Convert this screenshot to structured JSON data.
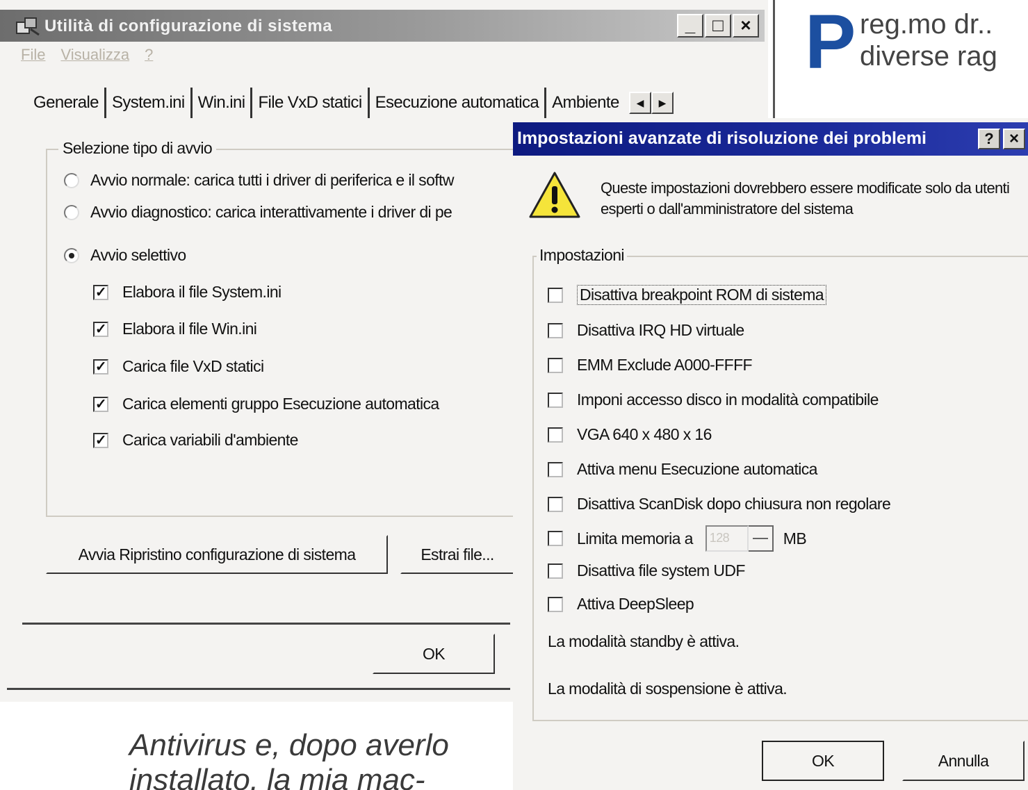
{
  "main_window": {
    "title": "Utilità di configurazione di sistema",
    "caption_buttons": {
      "minimize": "_",
      "maximize": "□",
      "close": "×"
    },
    "menu": [
      "File",
      "Visualizza",
      "?"
    ],
    "tabs": [
      "Generale",
      "System.ini",
      "Win.ini",
      "File VxD statici",
      "Esecuzione automatica",
      "Ambiente"
    ],
    "tab_scroll": {
      "left": "◀",
      "right": "▶"
    },
    "startup_group": {
      "legend": "Selezione tipo di avvio",
      "radio_normal": "Avvio normale: carica tutti i driver di periferica e il softw",
      "radio_diagnostic": "Avvio diagnostico: carica interattivamente i driver di pe",
      "radio_selective": "Avvio selettivo",
      "selected_radio": "radio_selective",
      "checks": [
        {
          "label": "Elabora il file System.ini",
          "checked": true
        },
        {
          "label": "Elabora il file Win.ini",
          "checked": true
        },
        {
          "label": "Carica file VxD statici",
          "checked": true
        },
        {
          "label": "Carica elementi gruppo Esecuzione automatica",
          "checked": true
        },
        {
          "label": "Carica variabili d'ambiente",
          "checked": true
        }
      ]
    },
    "buttons": {
      "restore": "Avvia Ripristino configurazione di sistema",
      "extract": "Estrai file...",
      "ok": "OK"
    }
  },
  "advanced_dialog": {
    "title": "Impostazioni avanzate di risoluzione dei problemi",
    "help_button": "?",
    "close_button": "×",
    "warning_text": "Queste impostazioni dovrebbero essere modificate solo da utenti esperti o dall'amministratore del sistema",
    "group_legend": "Impostazioni",
    "options": [
      {
        "label": "Disattiva breakpoint ROM di sistema",
        "checked": false
      },
      {
        "label": "Disattiva IRQ HD virtuale",
        "checked": false
      },
      {
        "label": "EMM Exclude A000-FFFF",
        "checked": false
      },
      {
        "label": "Imponi accesso disco in modalità compatibile",
        "checked": false
      },
      {
        "label": "VGA 640 x 480 x 16",
        "checked": false
      },
      {
        "label": "Attiva menu Esecuzione automatica",
        "checked": false
      },
      {
        "label": "Disattiva ScanDisk dopo chiusura non regolare",
        "checked": false
      },
      {
        "label": "Limita memoria a",
        "checked": false
      },
      {
        "label": "Disattiva file system UDF",
        "checked": false
      },
      {
        "label": "Attiva DeepSleep",
        "checked": false
      }
    ],
    "memory_value": "128",
    "memory_unit": "MB",
    "status_standby": "La modalità standby è attiva.",
    "status_suspend": "La modalità di sospensione è attiva.",
    "buttons": {
      "ok": "OK",
      "cancel": "Annulla"
    }
  },
  "magazine": {
    "drop_cap": "P",
    "top_line1": "reg.mo dr..",
    "top_line2": "diverse rag",
    "bottom_line1": "Antivirus e, dopo averlo",
    "bottom_line2": "installato, la mia mac-"
  },
  "colors": {
    "inactive_titlebar": "#8a8a8a",
    "active_titlebar": "#0d1a80",
    "window_face": "#f4f3f1",
    "drop_cap": "#1c4fa0"
  }
}
